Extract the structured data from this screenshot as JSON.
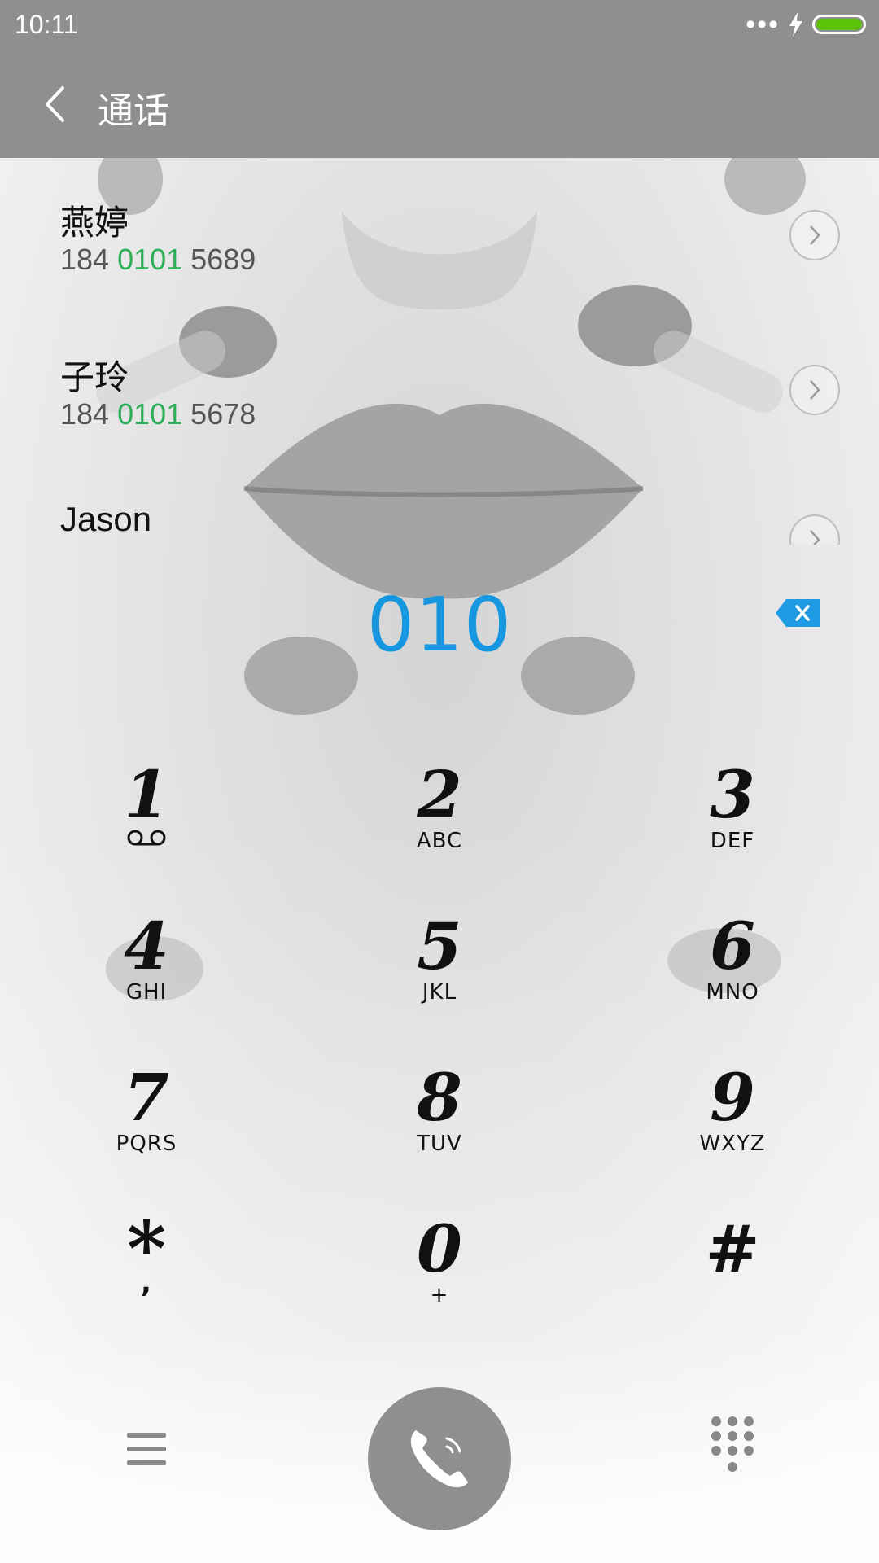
{
  "status_bar": {
    "time": "10:11",
    "more_indicator": "•••",
    "charging_icon": "lightning-icon",
    "battery_level": 1.0,
    "battery_color": "#5cc30a"
  },
  "app_bar": {
    "back_icon": "chevron-left-icon",
    "title": "通话",
    "background": "#8f8f8f"
  },
  "contacts": [
    {
      "name": "燕婷",
      "number_prefix": "184 ",
      "number_match": "0101",
      "number_suffix": " 5689"
    },
    {
      "name": "子玲",
      "number_prefix": "184 ",
      "number_match": "0101",
      "number_suffix": " 5678"
    },
    {
      "name": "Jason",
      "number_prefix": "",
      "number_match": "",
      "number_suffix": ""
    }
  ],
  "dialer": {
    "entered_number": "010",
    "entered_color": "#1797e0",
    "delete_icon": "backspace-icon"
  },
  "keypad": [
    {
      "digit": "1",
      "sub": "",
      "sub_icon": "voicemail-icon"
    },
    {
      "digit": "2",
      "sub": "ABC"
    },
    {
      "digit": "3",
      "sub": "DEF"
    },
    {
      "digit": "4",
      "sub": "GHI"
    },
    {
      "digit": "5",
      "sub": "JKL"
    },
    {
      "digit": "6",
      "sub": "MNO"
    },
    {
      "digit": "7",
      "sub": "PQRS"
    },
    {
      "digit": "8",
      "sub": "TUV"
    },
    {
      "digit": "9",
      "sub": "WXYZ"
    },
    {
      "digit": "*",
      "sub": ","
    },
    {
      "digit": "0",
      "sub": "+"
    },
    {
      "digit": "#",
      "sub": ""
    }
  ],
  "bottom_bar": {
    "menu_icon": "hamburger-menu-icon",
    "call_icon": "phone-handset-icon",
    "dialpad_icon": "dialpad-grid-icon"
  },
  "colors": {
    "match_highlight": "#2fae58",
    "call_button": "#8f8f8f"
  }
}
